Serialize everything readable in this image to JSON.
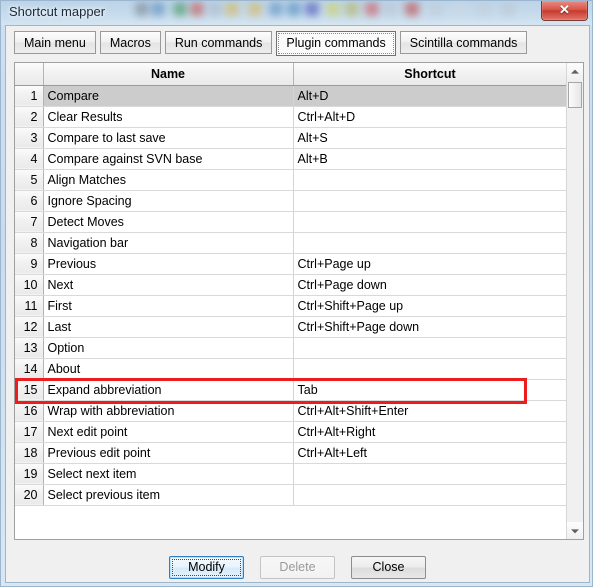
{
  "window": {
    "title": "Shortcut mapper",
    "close_label": "✕"
  },
  "tabs": [
    {
      "label": "Main menu",
      "selected": false
    },
    {
      "label": "Macros",
      "selected": false
    },
    {
      "label": "Run commands",
      "selected": false
    },
    {
      "label": "Plugin commands",
      "selected": true
    },
    {
      "label": "Scintilla commands",
      "selected": false
    }
  ],
  "grid": {
    "headers": {
      "num": "",
      "name": "Name",
      "shortcut": "Shortcut"
    },
    "rows": [
      {
        "num": "1",
        "name": "Compare",
        "shortcut": "Alt+D",
        "selected": true,
        "highlighted": false
      },
      {
        "num": "2",
        "name": "Clear Results",
        "shortcut": "Ctrl+Alt+D",
        "selected": false,
        "highlighted": false
      },
      {
        "num": "3",
        "name": "Compare to last save",
        "shortcut": "Alt+S",
        "selected": false,
        "highlighted": false
      },
      {
        "num": "4",
        "name": "Compare against SVN base",
        "shortcut": "Alt+B",
        "selected": false,
        "highlighted": false
      },
      {
        "num": "5",
        "name": "Align Matches",
        "shortcut": "",
        "selected": false,
        "highlighted": false
      },
      {
        "num": "6",
        "name": "Ignore Spacing",
        "shortcut": "",
        "selected": false,
        "highlighted": false
      },
      {
        "num": "7",
        "name": "Detect Moves",
        "shortcut": "",
        "selected": false,
        "highlighted": false
      },
      {
        "num": "8",
        "name": "Navigation bar",
        "shortcut": "",
        "selected": false,
        "highlighted": false
      },
      {
        "num": "9",
        "name": "Previous",
        "shortcut": "Ctrl+Page up",
        "selected": false,
        "highlighted": false
      },
      {
        "num": "10",
        "name": "Next",
        "shortcut": "Ctrl+Page down",
        "selected": false,
        "highlighted": false
      },
      {
        "num": "11",
        "name": "First",
        "shortcut": "Ctrl+Shift+Page up",
        "selected": false,
        "highlighted": false
      },
      {
        "num": "12",
        "name": "Last",
        "shortcut": "Ctrl+Shift+Page down",
        "selected": false,
        "highlighted": false
      },
      {
        "num": "13",
        "name": "Option",
        "shortcut": "",
        "selected": false,
        "highlighted": false
      },
      {
        "num": "14",
        "name": "About",
        "shortcut": "",
        "selected": false,
        "highlighted": false
      },
      {
        "num": "15",
        "name": "Expand abbreviation",
        "shortcut": "Tab",
        "selected": false,
        "highlighted": true
      },
      {
        "num": "16",
        "name": "Wrap with abbreviation",
        "shortcut": "Ctrl+Alt+Shift+Enter",
        "selected": false,
        "highlighted": false
      },
      {
        "num": "17",
        "name": "Next edit point",
        "shortcut": "Ctrl+Alt+Right",
        "selected": false,
        "highlighted": false
      },
      {
        "num": "18",
        "name": "Previous edit point",
        "shortcut": "Ctrl+Alt+Left",
        "selected": false,
        "highlighted": false
      },
      {
        "num": "19",
        "name": "Select next item",
        "shortcut": "",
        "selected": false,
        "highlighted": false
      },
      {
        "num": "20",
        "name": "Select previous item",
        "shortcut": "",
        "selected": false,
        "highlighted": false
      }
    ]
  },
  "scrollbar": {
    "up_icon": "scroll-up-arrow",
    "down_icon": "scroll-down-arrow",
    "thumb_icon": "scroll-thumb"
  },
  "buttons": {
    "modify": "Modify",
    "delete": "Delete",
    "close": "Close"
  },
  "colors": {
    "annotation_red": "#ee1c1c",
    "selection_gray": "#cccccc",
    "default_button_blue": "#2f7fc4",
    "close_button_red": "#c63a2e"
  }
}
